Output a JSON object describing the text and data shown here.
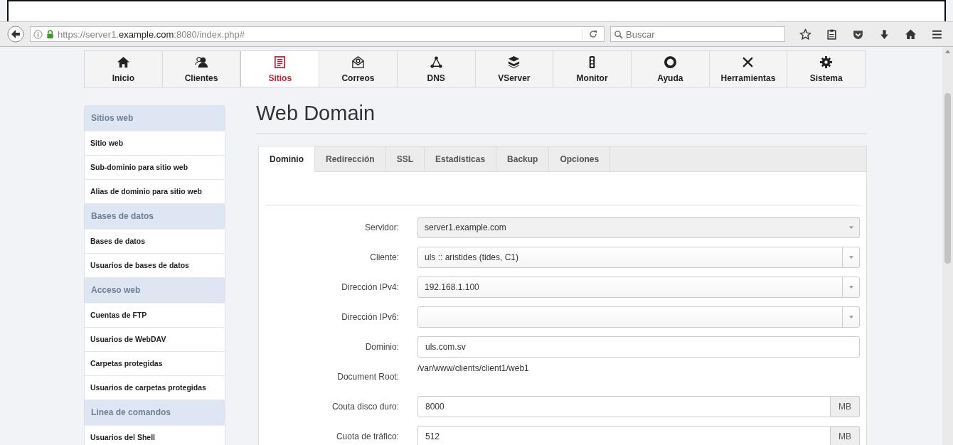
{
  "browser": {
    "url": "https://server1.**example.com**:8080/index.php#",
    "search": {
      "placeholder": "Buscar"
    }
  },
  "menu": [
    {
      "label": "Inicio",
      "selected": false
    },
    {
      "label": "Clientes",
      "selected": false
    },
    {
      "label": "Sitios",
      "selected": true
    },
    {
      "label": "Correos",
      "selected": false
    },
    {
      "label": "DNS",
      "selected": false
    },
    {
      "label": "VServer",
      "selected": false
    },
    {
      "label": "Monitor",
      "selected": false
    },
    {
      "label": "Ayuda",
      "selected": false
    },
    {
      "label": "Herramientas",
      "selected": false
    },
    {
      "label": "Sistema",
      "selected": false
    }
  ],
  "sidebar": [
    {
      "title": "Sitios web",
      "items": [
        "Sitio web",
        "Sub-dominio para sitio web",
        "Alias de dominio para sitio web"
      ]
    },
    {
      "title": "Bases de datos",
      "items": [
        "Bases de datos",
        "Usuarios de bases de datos"
      ]
    },
    {
      "title": "Acceso web",
      "items": [
        "Cuentas de FTP",
        "Usuarios de WebDAV",
        "Carpetas protegidas",
        "Usuarios de carpetas protegidas"
      ]
    },
    {
      "title": "Linea de comandos",
      "items": [
        "Usuarios del Shell"
      ]
    }
  ],
  "title": "Web Domain",
  "tabs": [
    {
      "label": "Dominio",
      "selected": true
    },
    {
      "label": "Redirección",
      "selected": false
    },
    {
      "label": "SSL",
      "selected": false
    },
    {
      "label": "Estadísticas",
      "selected": false
    },
    {
      "label": "Backup",
      "selected": false
    },
    {
      "label": "Opciones",
      "selected": false
    }
  ],
  "fields": [
    {
      "label": "Servidor:",
      "kind": "select",
      "value": "server1.example.com",
      "disabled": true
    },
    {
      "label": "Cliente:",
      "kind": "select",
      "value": "uls :: aristides (tides, C1)",
      "disabled": false
    },
    {
      "label": "Dirección IPv4:",
      "kind": "select",
      "value": "192.168.1.100",
      "disabled": false
    },
    {
      "label": "Dirección IPv6:",
      "kind": "select",
      "disabled": false
    },
    {
      "label": "Dominio:",
      "kind": "text",
      "value": "uls.com.sv"
    },
    {
      "label": "Document Root:",
      "kind": "static",
      "value": "/var/www/clients/client1/web1"
    },
    {
      "label": "Couta disco duro:",
      "kind": "addon",
      "value": "8000",
      "addon": "MB"
    },
    {
      "label": "Cuota de tráfico:",
      "kind": "addon",
      "value": "512",
      "addon": "MB"
    }
  ]
}
